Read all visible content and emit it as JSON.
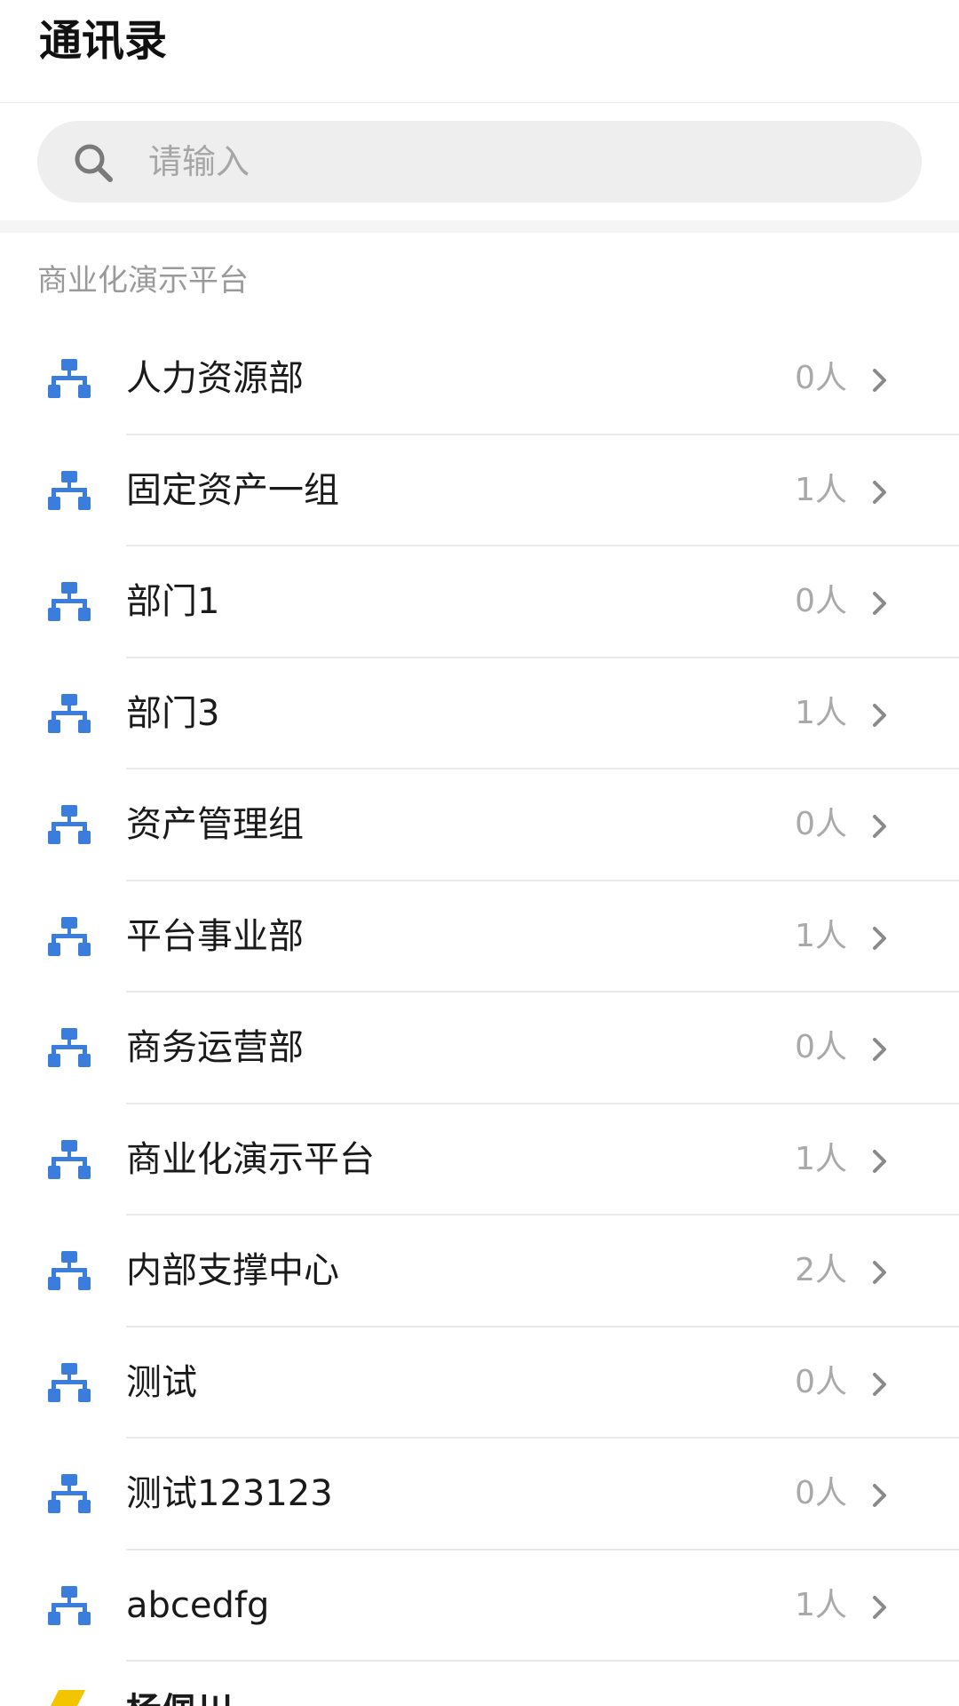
{
  "header": {
    "title": "通讯录"
  },
  "search": {
    "placeholder": "请输入",
    "icon": "search-icon"
  },
  "section": {
    "label": "商业化演示平台"
  },
  "colors": {
    "accent": "#3b7ddd",
    "member_avatar": "#f2c500"
  },
  "departments": [
    {
      "name": "人力资源部",
      "count": "0人"
    },
    {
      "name": "固定资产一组",
      "count": "1人"
    },
    {
      "name": "部门1",
      "count": "0人"
    },
    {
      "name": "部门3",
      "count": "1人"
    },
    {
      "name": "资产管理组",
      "count": "0人"
    },
    {
      "name": "平台事业部",
      "count": "1人"
    },
    {
      "name": "商务运营部",
      "count": "0人"
    },
    {
      "name": "商业化演示平台",
      "count": "1人"
    },
    {
      "name": "内部支撑中心",
      "count": "2人"
    },
    {
      "name": "测试",
      "count": "0人"
    },
    {
      "name": "测试123123",
      "count": "0人"
    },
    {
      "name": "abcedfg",
      "count": "1人"
    }
  ],
  "member_partial": {
    "name": "杨佩川"
  }
}
